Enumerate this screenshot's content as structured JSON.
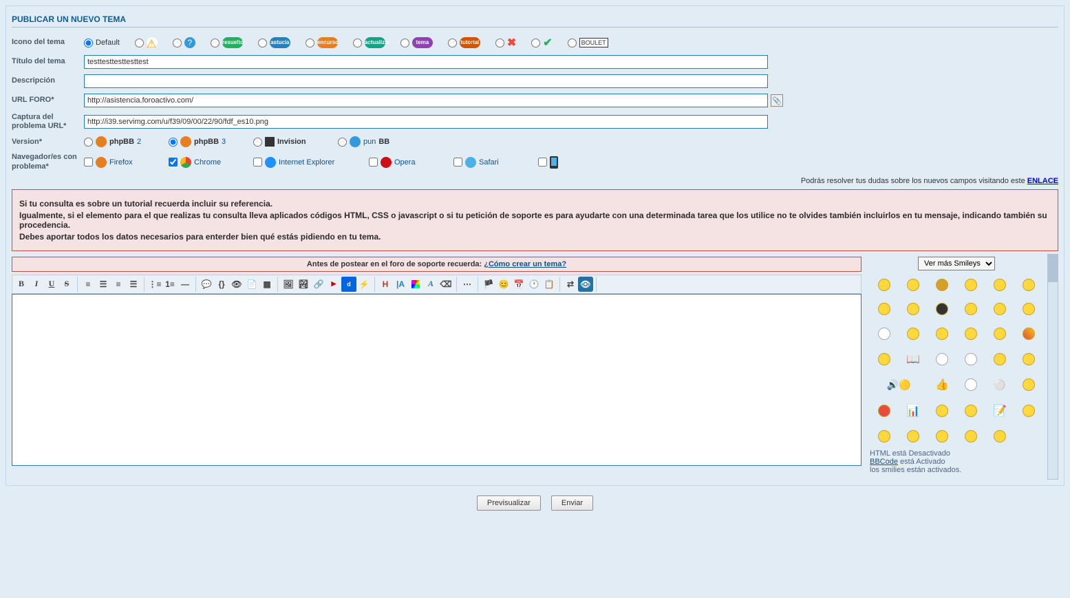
{
  "title": "PUBLICAR UN NUEVO TEMA",
  "fields": {
    "icon_label": "Icono del tema",
    "default_label": "Default",
    "subject_label": "Título del tema",
    "subject_value": "testtesttesttesttest",
    "desc_label": "Descripción",
    "desc_value": "",
    "url_label": "URL FORO*",
    "url_value": "http://asistencia.foroactivo.com/",
    "capture_label": "Captura del problema URL*",
    "capture_value": "http://i39.servimg.com/u/f39/09/00/22/90/fdf_es10.png",
    "version_label": "Version*",
    "browser_label": "Navegador/es con problema*"
  },
  "versions": {
    "phpbb2": "phpBB ",
    "phpbb2_suffix": "2",
    "phpbb3": "phpBB ",
    "phpbb3_suffix": "3",
    "invision": "Invision",
    "punbb": "pun",
    "punbb_suffix": "BB"
  },
  "browsers": {
    "firefox": "Firefox",
    "chrome": "Chrome",
    "ie": "Internet Explorer",
    "opera": "Opera",
    "safari": "Safari"
  },
  "notice_prefix": "Podrás resolver tus dudas sobre los nuevos campos visitando este ",
  "notice_link": "ENLACE",
  "warn": {
    "p1": "Si tu consulta es sobre un tutorial recuerda incluir su referencia.",
    "p2": "Igualmente, si el elemento para el que realizas tu consulta lleva aplicados códigos HTML, CSS o javascript o si tu petición de soporte es para ayudarte con una determinada tarea que los utilice no te olvides también incluirlos en tu mensaje, indicando también su procedencia.",
    "p3": "Debes aportar todos los datos necesarios para enterder bien qué estás pidiendo en tu tema."
  },
  "reminder_prefix": "Antes de postear en el foro de soporte recuerda: ",
  "reminder_link": "¿Cómo crear un tema?",
  "smiley_select": "Ver más Smileys",
  "status": {
    "html": "HTML está Desactivado",
    "bbcode_link": "BBCode",
    "bbcode_text": " está Activado",
    "smilies": "los smilies están activados."
  },
  "buttons": {
    "preview": "Previsualizar",
    "submit": "Enviar"
  }
}
